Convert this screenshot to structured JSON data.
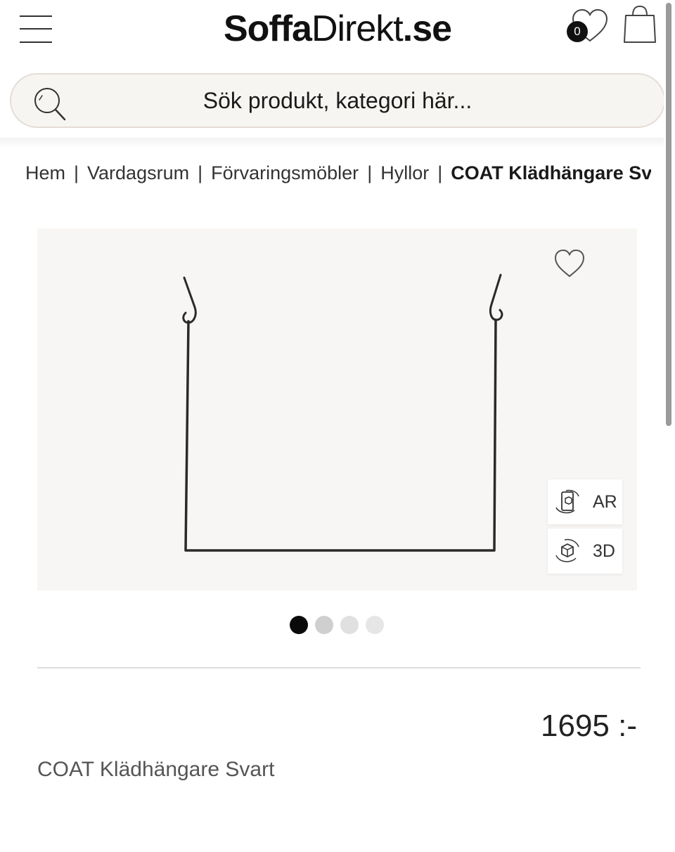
{
  "header": {
    "logo": {
      "part1": "Soffa",
      "part2": "Direkt",
      "part3": ".se"
    },
    "wishlist_count": "0"
  },
  "search": {
    "placeholder": "Sök produkt, kategori här..."
  },
  "breadcrumb": {
    "items": [
      "Hem",
      "Vardagsrum",
      "Förvaringsmöbler",
      "Hyllor"
    ],
    "current": "COAT Klädhängare Svart",
    "separator": "|"
  },
  "gallery": {
    "ar_label": "AR",
    "threed_label": "3D",
    "slide_count": 4,
    "active_slide": 1
  },
  "product": {
    "price": "1695 :-",
    "title": "COAT Klädhängare Svart"
  },
  "colors": {
    "dot_active": "#0a0a0a",
    "dot_inactive": [
      "#cfcfcf",
      "#e0e0e0",
      "#e6e6e6"
    ],
    "search_border": "#e4ddd5",
    "image_bg": "#f7f6f4"
  }
}
